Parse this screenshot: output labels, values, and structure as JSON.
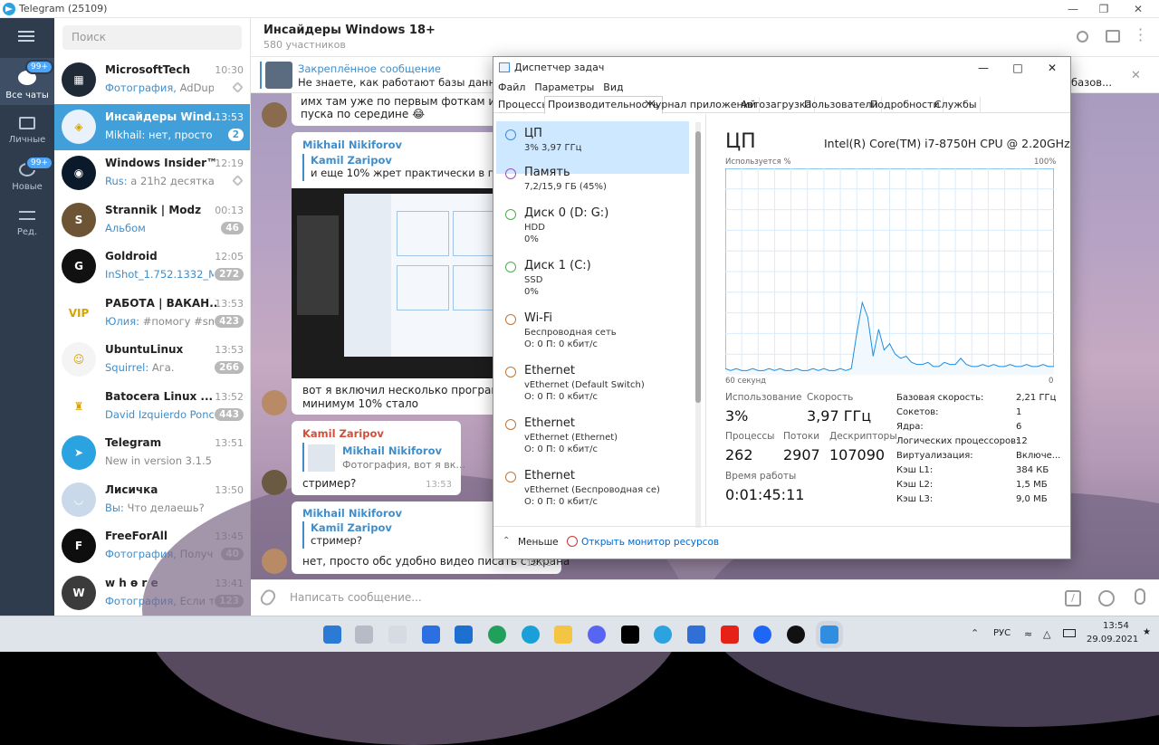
{
  "telegram": {
    "title": "Telegram (25109)",
    "rail": [
      {
        "label": "Все чаты",
        "badge": "99+"
      },
      {
        "label": "Личные",
        "badge": ""
      },
      {
        "label": "Новые",
        "badge": "99+"
      },
      {
        "label": "Ред.",
        "badge": ""
      }
    ],
    "search_placeholder": "Поиск",
    "chats": [
      {
        "name": "MicrosoftTech",
        "time": "10:30",
        "sender": "Фотография,",
        "preview": " AdDuplex: ...",
        "badge": "",
        "pinned": true,
        "avatar_color": "#1f2a36",
        "avatar_text": "▦"
      },
      {
        "name": "Инсайдеры Wind...",
        "time": "13:53",
        "sender": "Mikhail:",
        "preview": " нет, просто обс ...",
        "badge": "2",
        "pinned": false,
        "avatar_color": "#e9f1fb",
        "avatar_text": "◈"
      },
      {
        "name": "Windows Insider™ ...",
        "time": "12:19",
        "sender": "Rus:",
        "preview": " а 21h2 десятка вме...",
        "badge": "",
        "pinned": true,
        "avatar_color": "#0b1a2b",
        "avatar_text": "◉"
      },
      {
        "name": "Strannik | Modz",
        "time": "00:13",
        "sender": "Альбом",
        "preview": "",
        "badge": "46",
        "pinned": false,
        "avatar_color": "#6d5434",
        "avatar_text": "S"
      },
      {
        "name": "Goldroid",
        "time": "12:05",
        "sender": "InShot_1.752.1332_MO...",
        "preview": "",
        "badge": "272",
        "pinned": false,
        "avatar_color": "#111111",
        "avatar_text": "G"
      },
      {
        "name": "РАБОТА | ВАКАН...",
        "time": "13:53",
        "sender": "Юлия:",
        "preview": " #помогу #smm...",
        "badge": "423",
        "pinned": false,
        "avatar_color": "#ffffff",
        "avatar_text": "VIP"
      },
      {
        "name": "UbuntuLinux",
        "time": "13:53",
        "sender": "Squirrel:",
        "preview": " Ага.",
        "badge": "266",
        "pinned": false,
        "avatar_color": "#f4f4f4",
        "avatar_text": "☺"
      },
      {
        "name": "Batocera Linux ...",
        "time": "13:52",
        "sender": "David Izquierdo Ponce...",
        "preview": "",
        "badge": "443",
        "pinned": false,
        "avatar_color": "#ffffff",
        "avatar_text": "♜"
      },
      {
        "name": "Telegram",
        "time": "13:51",
        "sender": "",
        "preview": "New in version 3.1.5 beta: ...",
        "badge": "",
        "pinned": false,
        "avatar_color": "#2aa3e0",
        "avatar_text": "➤"
      },
      {
        "name": "Лисичка",
        "time": "13:50",
        "sender": "Вы:",
        "preview": " Что делаешь?",
        "badge": "",
        "pinned": false,
        "avatar_color": "#c9d9ea",
        "avatar_text": "◡"
      },
      {
        "name": "FreeForAll",
        "time": "13:45",
        "sender": "Фотография,",
        "preview": " Получае...",
        "badge": "40",
        "pinned": false,
        "avatar_color": "#0e0e0e",
        "avatar_text": "F"
      },
      {
        "name": "w h ɵ r e",
        "time": "13:41",
        "sender": "Фотография,",
        "preview": " Если ты ...",
        "badge": "123",
        "pinned": false,
        "avatar_color": "#3b3b3b",
        "avatar_text": "W"
      }
    ],
    "header": {
      "title": "Инсайдеры Windows 18+",
      "subtitle": "580 участников"
    },
    "pinned": {
      "label": "Закреплённое сообщение",
      "text": "Не знаете, как работают базы данных в о",
      "tail": "базов..."
    },
    "messages": [
      {
        "text": "имх там уже по первым фоткам им доне",
        "text2": "пуска по середине 😂"
      },
      {
        "author": "Mikhail Nikiforov",
        "reply_author": "Kamil Zaripov",
        "reply_text": "и еще 10% жрет практически в простое",
        "text": "вот я включил несколько программ, плю",
        "text2": "минимум 10% стало"
      },
      {
        "author": "Kamil Zaripov",
        "reply_author": "Mikhail Nikiforov",
        "reply_text": "Фотография, вот я вк...",
        "text": "стример?",
        "time": "13:53"
      },
      {
        "author": "Mikhail Nikiforov",
        "reply_author": "Kamil Zaripov",
        "reply_text": "стример?",
        "text": "нет, просто обс удобно видео писать с экрана",
        "time": "13:53"
      }
    ],
    "composer_placeholder": "Написать сообщение..."
  },
  "taskmgr": {
    "title": "Диспетчер задач",
    "menu": [
      "Файл",
      "Параметры",
      "Вид"
    ],
    "tabs": [
      "Процессы",
      "Производительность",
      "Журнал приложений",
      "Автозагрузка",
      "Пользователи",
      "Подробности",
      "Службы"
    ],
    "resources": [
      {
        "title": "ЦП",
        "line1": "3% 3,97 ГГц",
        "line2": "",
        "color": "#3c8edb"
      },
      {
        "title": "Память",
        "line1": "7,2/15,9 ГБ (45%)",
        "line2": "",
        "color": "#a24fbf"
      },
      {
        "title": "Диск 0 (D: G:)",
        "line1": "HDD",
        "line2": "0%",
        "color": "#4cae4c"
      },
      {
        "title": "Диск 1 (C:)",
        "line1": "SSD",
        "line2": "0%",
        "color": "#4cae4c"
      },
      {
        "title": "Wi-Fi",
        "line1": "Беспроводная сеть",
        "line2": "О: 0 П: 0 кбит/с",
        "color": "#c0763a"
      },
      {
        "title": "Ethernet",
        "line1": "vEthernet (Default Switch)",
        "line2": "О: 0 П: 0 кбит/с",
        "color": "#c0763a"
      },
      {
        "title": "Ethernet",
        "line1": "vEthernet (Ethernet)",
        "line2": "О: 0 П: 0 кбит/с",
        "color": "#c0763a"
      },
      {
        "title": "Ethernet",
        "line1": "vEthernet (Беспроводная се)",
        "line2": "О: 0 П: 0 кбит/с",
        "color": "#c0763a"
      }
    ],
    "detail_title": "ЦП",
    "cpu_name": "Intel(R) Core(TM) i7-8750H CPU @ 2.20GHz",
    "graph_label": "Используется %",
    "graph_max": "100%",
    "graph_left": "60 секунд",
    "graph_right": "0",
    "stats": {
      "usage_label": "Использование",
      "usage": "3%",
      "speed_label": "Скорость",
      "speed": "3,97 ГГц",
      "proc_label": "Процессы",
      "proc": "262",
      "threads_label": "Потоки",
      "threads": "2907",
      "handles_label": "Дескрипторы",
      "handles": "107090",
      "uptime_label": "Время работы",
      "uptime": "0:01:45:11"
    },
    "kv": [
      [
        "Базовая скорость:",
        "2,21 ГГц"
      ],
      [
        "Сокетов:",
        "1"
      ],
      [
        "Ядра:",
        "6"
      ],
      [
        "Логических процессоров:",
        "12"
      ],
      [
        "Виртуализация:",
        "Включе..."
      ],
      [
        "Кэш L1:",
        "384 КБ"
      ],
      [
        "Кэш L2:",
        "1,5 МБ"
      ],
      [
        "Кэш L3:",
        "9,0 МБ"
      ]
    ],
    "fewer": "Меньше",
    "resmon": "Открыть монитор ресурсов",
    "cpu_history": [
      3,
      2,
      3,
      2,
      2,
      3,
      2,
      2,
      3,
      2,
      3,
      2,
      2,
      3,
      2,
      2,
      3,
      2,
      3,
      2,
      2,
      3,
      2,
      3,
      20,
      35,
      28,
      9,
      22,
      12,
      15,
      10,
      8,
      9,
      6,
      5,
      5,
      6,
      4,
      4,
      6,
      5,
      5,
      8,
      5,
      4,
      4,
      5,
      4,
      5,
      4,
      4,
      5,
      4,
      4,
      5,
      4,
      4,
      5,
      4,
      4
    ]
  },
  "taskbar": {
    "lang": "РУС",
    "time": "13:54",
    "date": "29.09.2021"
  }
}
